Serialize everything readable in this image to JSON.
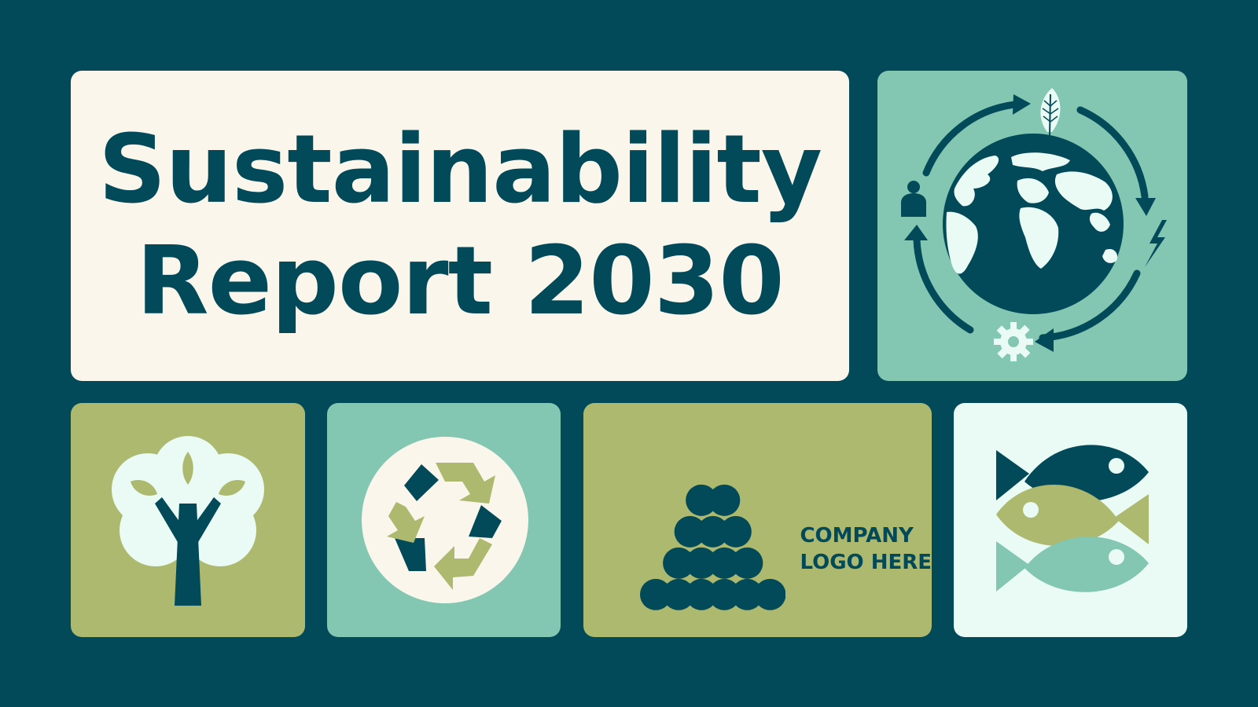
{
  "title": {
    "line1": "Sustainability",
    "line2": "Report 2030"
  },
  "logo": {
    "line1": "COMPANY",
    "line2": "LOGO HERE"
  },
  "icons": {
    "globe": "globe-cycle-icon",
    "leaf": "leaf-icon",
    "person": "person-icon",
    "lightning": "lightning-icon",
    "gear": "gear-icon",
    "tree": "tree-icon",
    "recycle": "recycle-icon",
    "logo": "stacked-circles-logo-icon",
    "fish": "fish-icon"
  },
  "colors": {
    "background": "#02495A",
    "cream": "#FBF6EC",
    "teal": "#83C6B2",
    "olive": "#ADB96E",
    "mint": "#EAFAF4"
  }
}
